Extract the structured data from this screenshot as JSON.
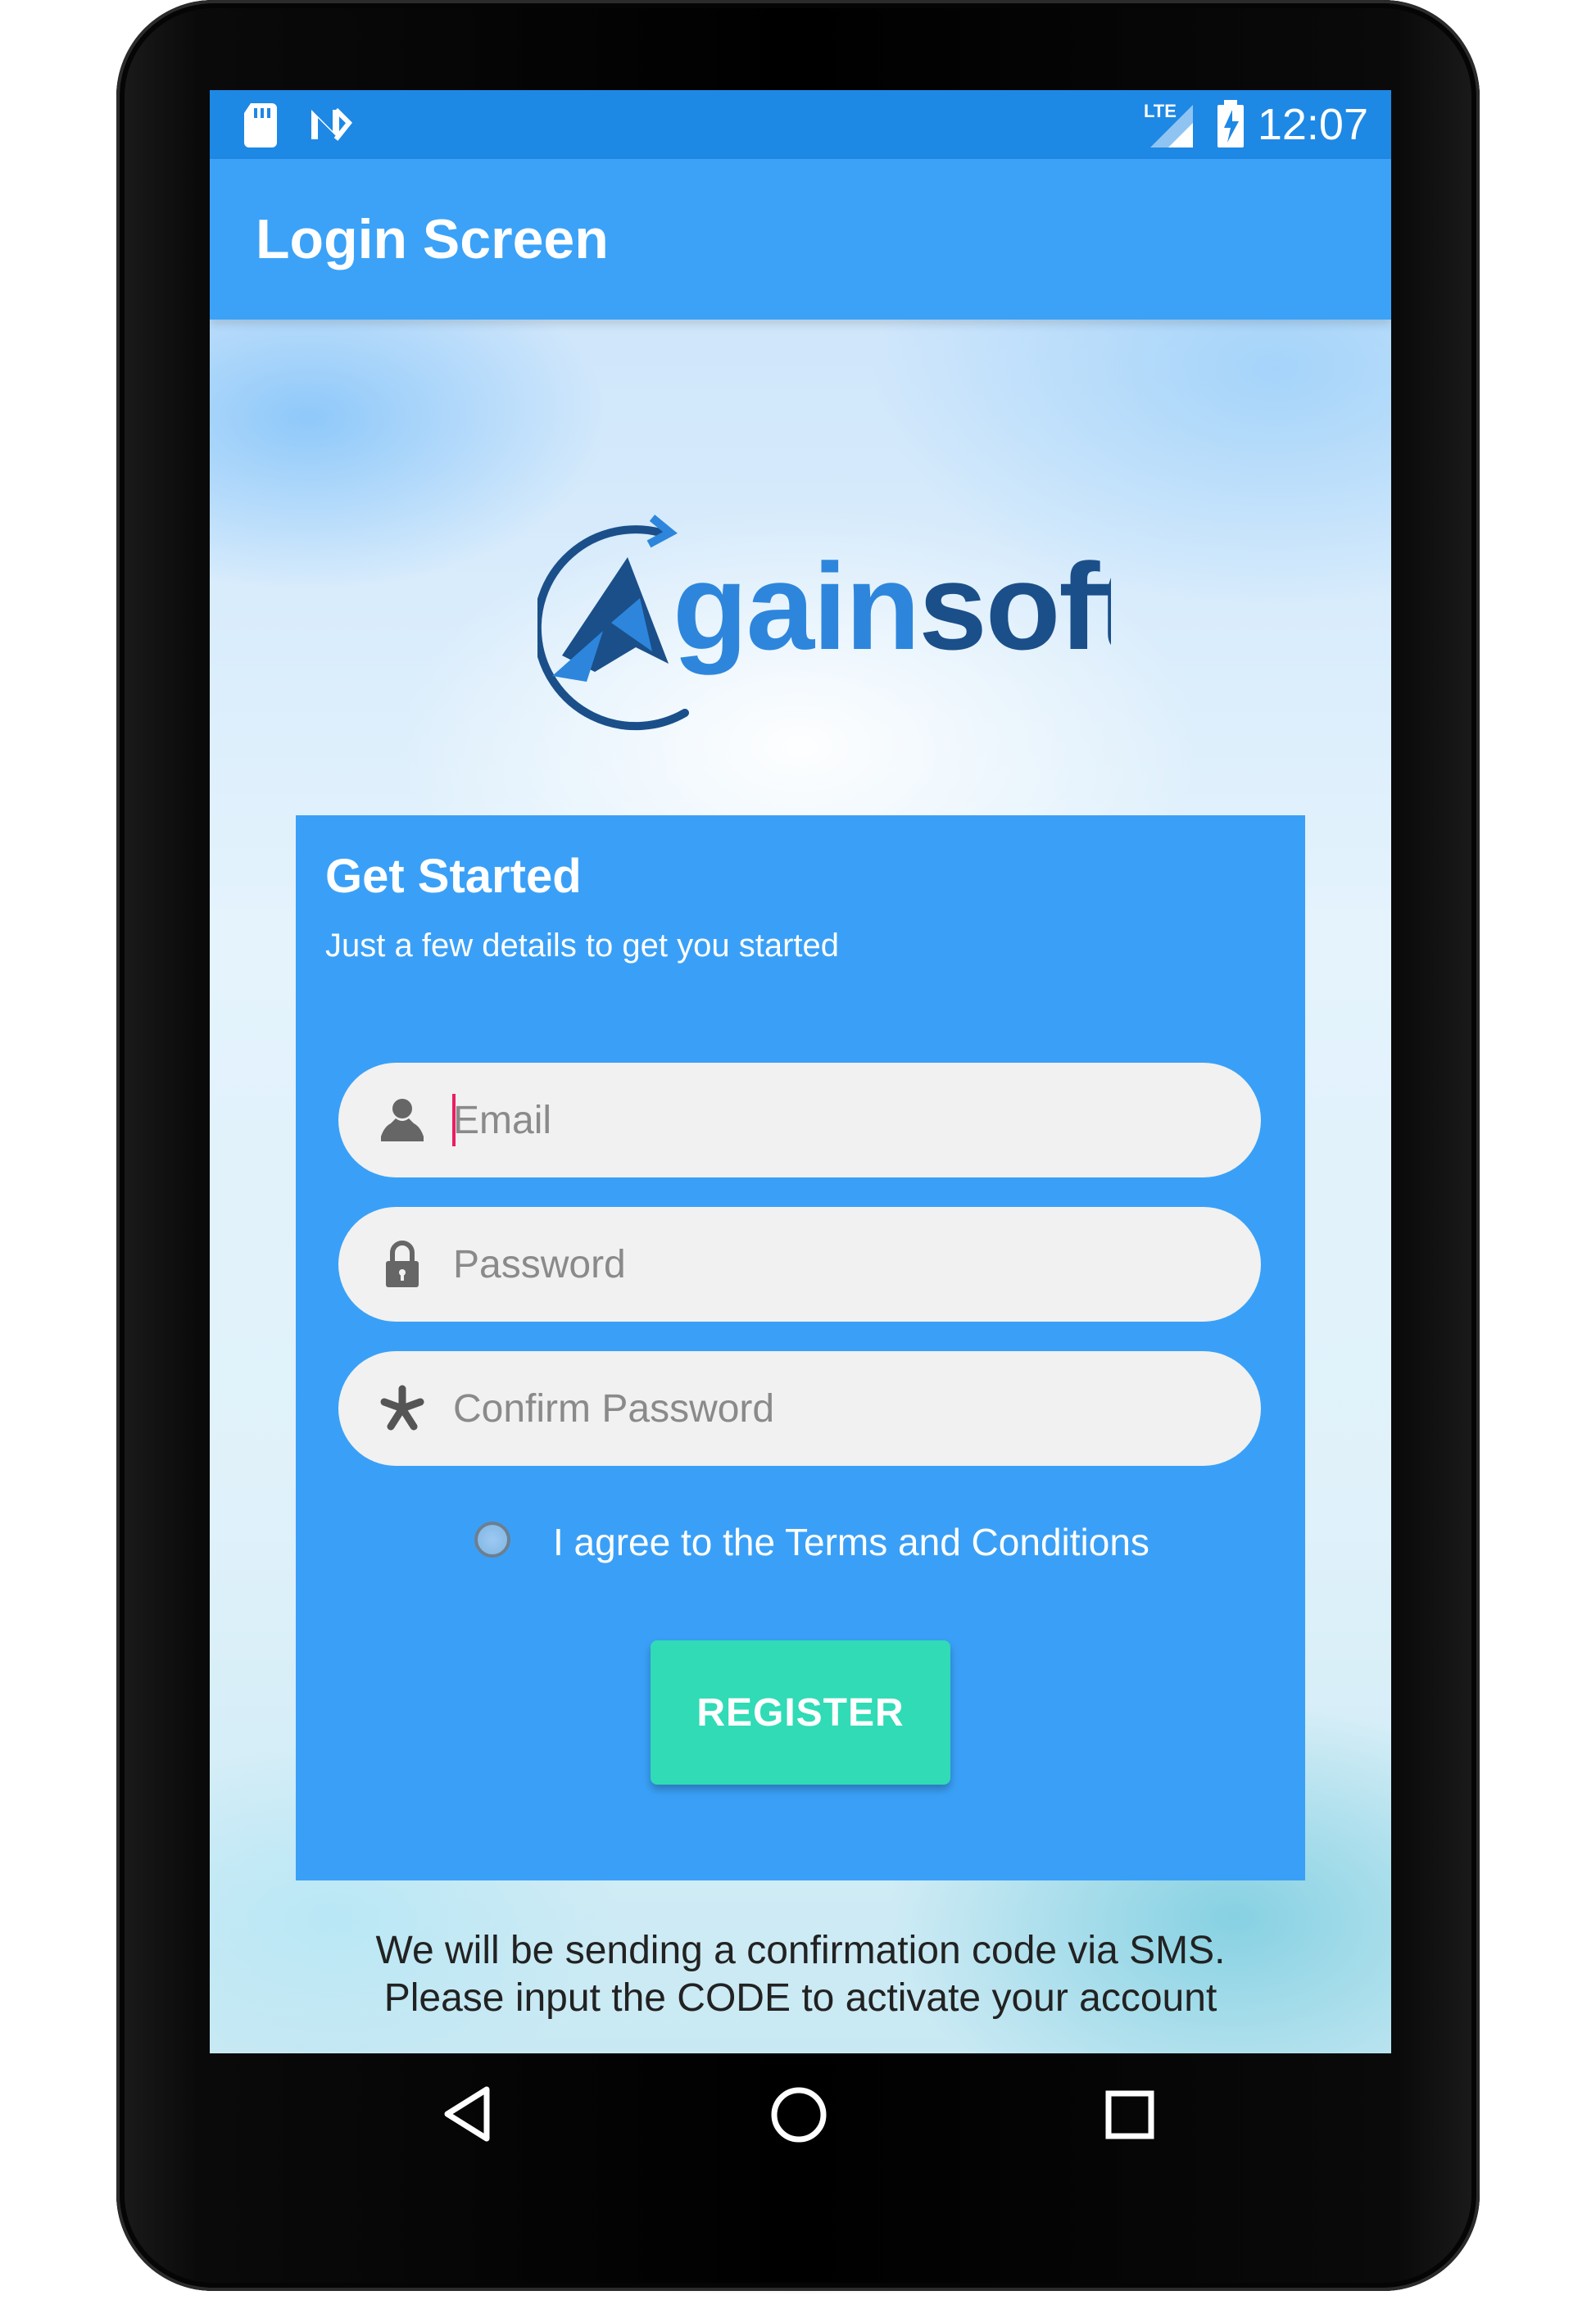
{
  "status_bar": {
    "time": "12:07",
    "icons": [
      "sd-card-icon",
      "notification-n-icon",
      "lte-signal-icon",
      "battery-charging-icon"
    ],
    "network_label": "LTE"
  },
  "app_bar": {
    "title": "Login Screen"
  },
  "logo": {
    "text": "Againsoft",
    "colors": {
      "dark": "#1b4f8a",
      "light": "#2d86dc"
    }
  },
  "card": {
    "title": "Get Started",
    "subtitle": "Just a few details to get you started",
    "fields": [
      {
        "placeholder": "Email",
        "value": "",
        "icon": "person-icon",
        "focused": true
      },
      {
        "placeholder": "Password",
        "value": "",
        "icon": "lock-icon"
      },
      {
        "placeholder": "Confirm Password",
        "value": "",
        "icon": "asterisk-icon"
      }
    ],
    "agree_label": "I agree to the Terms and Conditions",
    "agree_checked": false,
    "register_label": "REGISTER",
    "colors": {
      "card": "#3aa0f7",
      "button": "#30dbb6"
    }
  },
  "sms_note": {
    "line1": "We will be sending a confirmation code via SMS.",
    "line2": "Please input the CODE to activate your account"
  },
  "nav_bar": {
    "buttons": [
      "back-icon",
      "home-icon",
      "recents-icon"
    ]
  },
  "colors": {
    "status_bar": "#1e88e5",
    "app_bar": "#3ba2f7"
  }
}
